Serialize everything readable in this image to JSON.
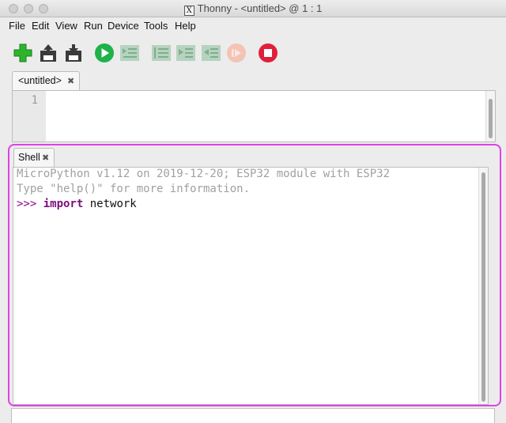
{
  "window": {
    "title": "Thonny  -  <untitled>  @  1 : 1",
    "x_icon_glyph": "X"
  },
  "menu": {
    "items": [
      {
        "label": "File"
      },
      {
        "label": "Edit"
      },
      {
        "label": "View"
      },
      {
        "label": "Run"
      },
      {
        "label": "Device"
      },
      {
        "label": "Tools"
      },
      {
        "label": "Help"
      }
    ]
  },
  "toolbar": {
    "buttons": [
      {
        "name": "new-file-icon",
        "state": "enabled",
        "color": "#2db42d"
      },
      {
        "name": "open-file-icon",
        "state": "enabled",
        "color": "#333333"
      },
      {
        "name": "save-file-icon",
        "state": "enabled",
        "color": "#333333"
      },
      {
        "name": "run-icon",
        "state": "enabled",
        "color": "#1fb14a"
      },
      {
        "name": "debug-icon",
        "state": "disabled",
        "color": "#8fbf9c"
      },
      {
        "name": "step-over-icon",
        "state": "disabled",
        "color": "#8fbf9c"
      },
      {
        "name": "step-into-icon",
        "state": "disabled",
        "color": "#8fbf9c"
      },
      {
        "name": "step-out-icon",
        "state": "disabled",
        "color": "#8fbf9c"
      },
      {
        "name": "resume-icon",
        "state": "disabled",
        "color": "#f0b8a8"
      },
      {
        "name": "stop-icon",
        "state": "enabled",
        "color": "#e0203a"
      }
    ]
  },
  "editor": {
    "tab_label": "<untitled>",
    "close_glyph": "✖",
    "line_number": "1"
  },
  "shell": {
    "tab_label": "Shell",
    "close_glyph": "✖",
    "banner_line1": "MicroPython v1.12 on 2019-12-20; ESP32 module with ESP32",
    "banner_line2": "Type \"help()\" for more information.",
    "prompt": ">>> ",
    "keyword": "import",
    "code_rest": " network"
  },
  "colors": {
    "highlight_border": "#e040e6",
    "prompt": "#8b0a8b",
    "banner_text": "#a0a0a0"
  }
}
